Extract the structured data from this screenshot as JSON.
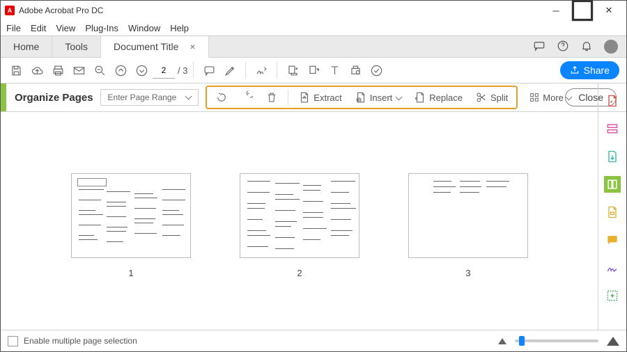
{
  "app": {
    "title": "Adobe Acrobat Pro DC"
  },
  "menu": [
    "File",
    "Edit",
    "View",
    "Plug-Ins",
    "Window",
    "Help"
  ],
  "tabs": {
    "home": "Home",
    "tools": "Tools",
    "doc": "Document Title"
  },
  "toolbar": {
    "current_page": "2",
    "total_pages": "/ 3",
    "share": "Share"
  },
  "organize": {
    "title": "Organize Pages",
    "range": "Enter Page Range",
    "extract": "Extract",
    "insert": "Insert",
    "replace": "Replace",
    "split": "Split",
    "more": "More",
    "close": "Close"
  },
  "pages": {
    "p1": "1",
    "p2": "2",
    "p3": "3"
  },
  "footer": {
    "checkbox": "Enable multiple page selection"
  }
}
